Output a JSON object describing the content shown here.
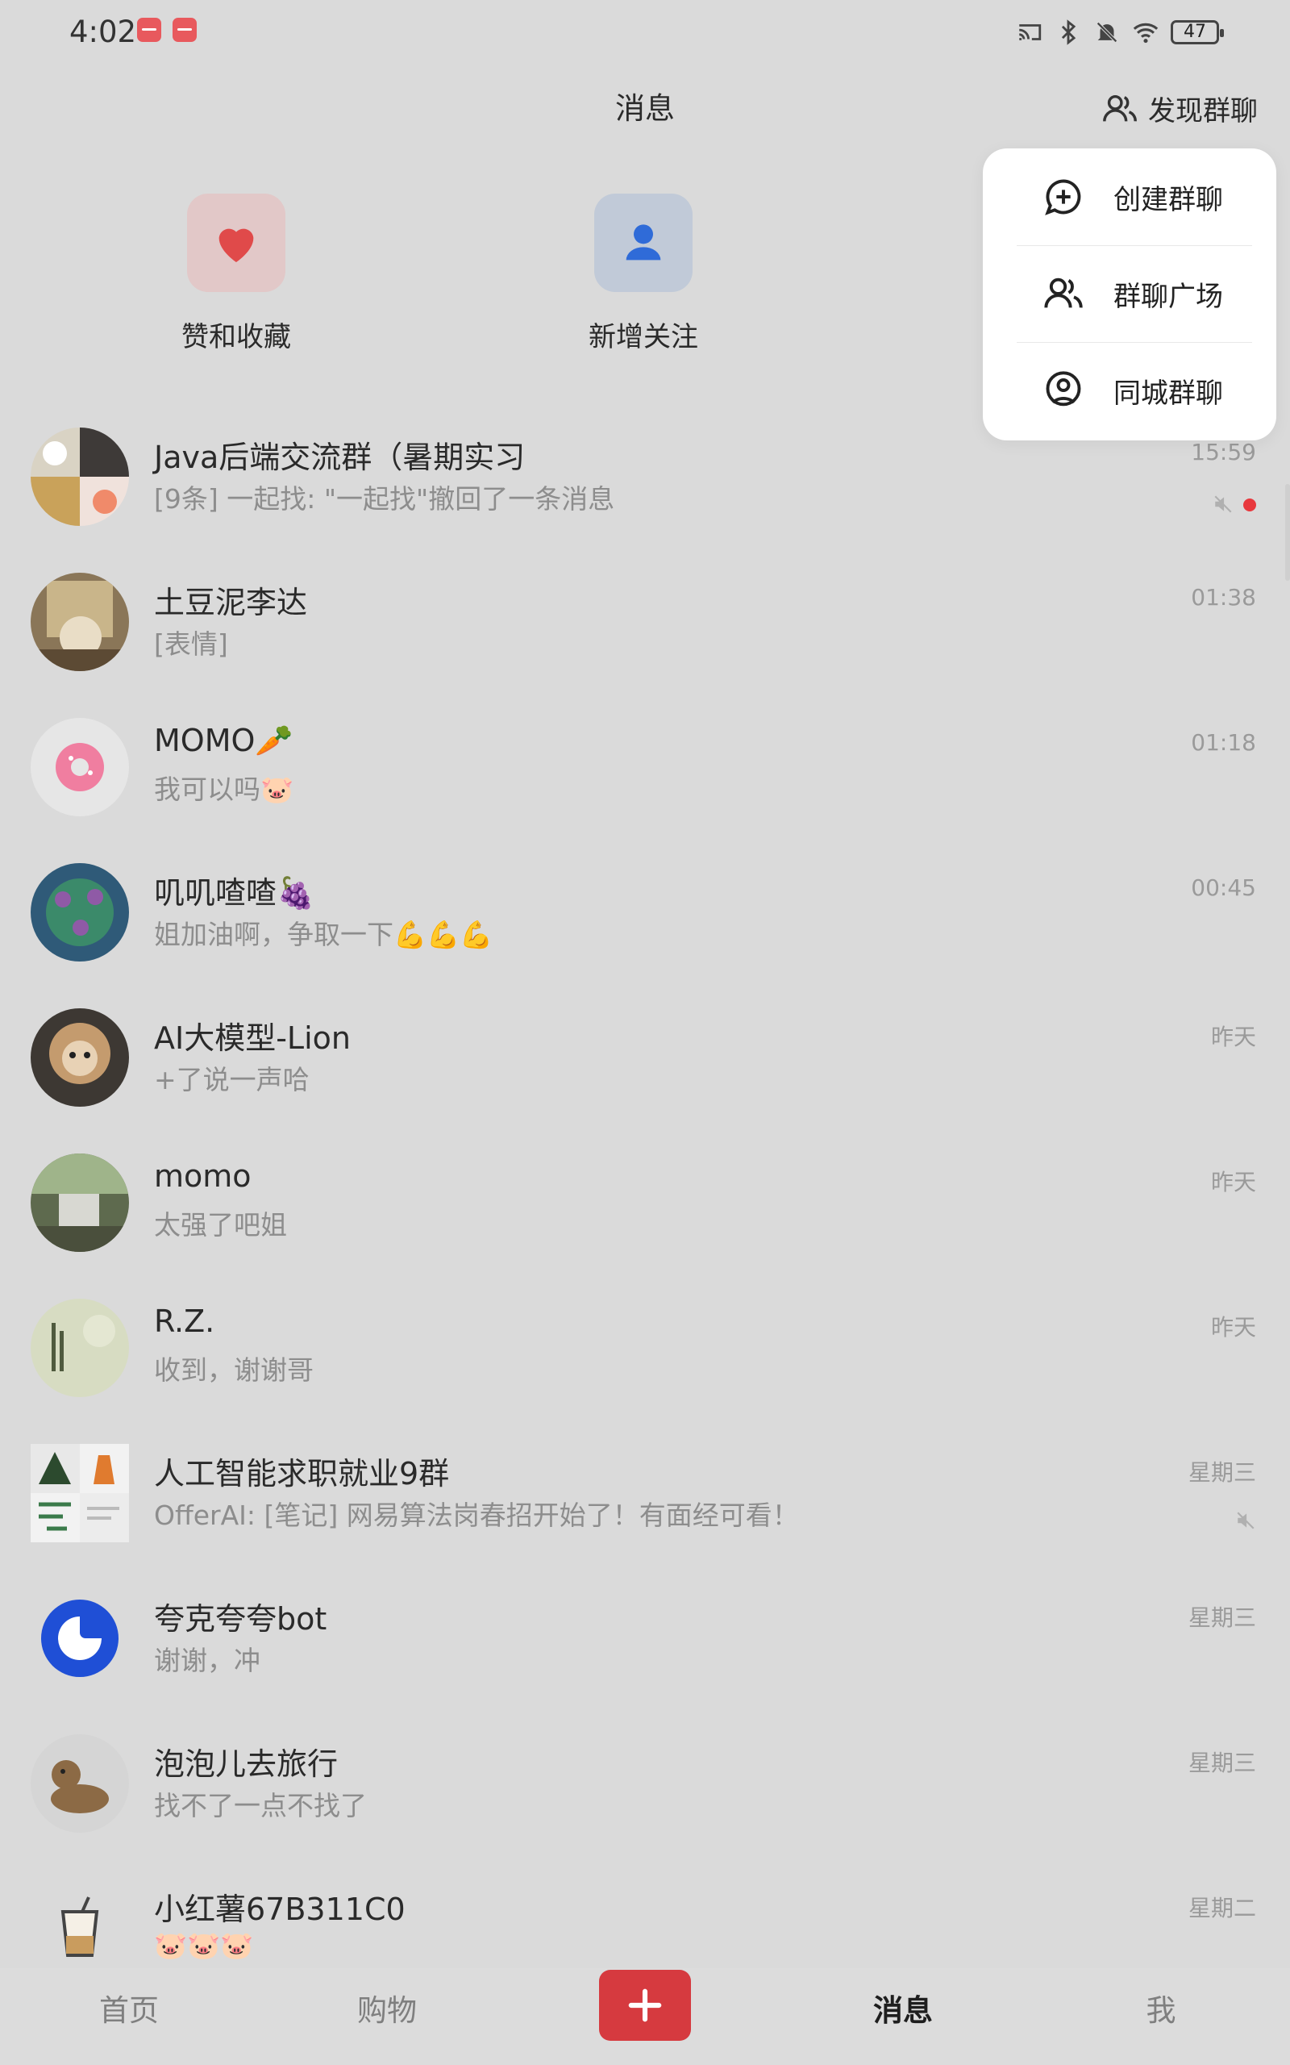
{
  "status_bar": {
    "time": "4:02",
    "battery": "47"
  },
  "header": {
    "title": "消息",
    "discover_label": "发现群聊"
  },
  "quick_entries": [
    {
      "label": "赞和收藏",
      "icon": "heart-icon"
    },
    {
      "label": "新增关注",
      "icon": "person-icon"
    }
  ],
  "popup_menu": [
    {
      "label": "创建群聊",
      "icon": "add-chat-icon"
    },
    {
      "label": "群聊广场",
      "icon": "group-icon"
    },
    {
      "label": "同城群聊",
      "icon": "location-icon"
    }
  ],
  "chats": [
    {
      "name": "Java后端交流群（暑期实习",
      "message": "[9条] 一起找: \"一起找\"撤回了一条消息",
      "time": "15:59",
      "muted": true,
      "unread": true
    },
    {
      "name": "土豆泥李达",
      "message": "[表情]",
      "time": "01:38"
    },
    {
      "name": "MOMO🥕",
      "message": "我可以吗🐷",
      "time": "01:18"
    },
    {
      "name": "叽叽喳喳🍇",
      "message": "姐加油啊，争取一下💪💪💪",
      "time": "00:45"
    },
    {
      "name": "AI大模型-Lion",
      "message": "+了说一声哈",
      "time": "昨天"
    },
    {
      "name": "momo",
      "message": "太强了吧姐",
      "time": "昨天"
    },
    {
      "name": "R.Z.",
      "message": "收到，谢谢哥",
      "time": "昨天"
    },
    {
      "name": "人工智能求职就业9群",
      "message": "OfferAI: [笔记] 网易算法岗春招开始了！有面经可看！",
      "time": "星期三",
      "muted": true
    },
    {
      "name": "夸克夸夸bot",
      "message": "谢谢，冲",
      "time": "星期三"
    },
    {
      "name": "泡泡儿去旅行",
      "message": "找不了一点不找了",
      "time": "星期三"
    },
    {
      "name": "小红薯67B311C0",
      "message": "🐷🐷🐷",
      "time": "星期二"
    }
  ],
  "bottom_nav": {
    "home": "首页",
    "shop": "购物",
    "messages": "消息",
    "me": "我"
  },
  "colors": {
    "accent": "#d63a3f",
    "background": "#dadada",
    "unread": "#e8383d"
  }
}
